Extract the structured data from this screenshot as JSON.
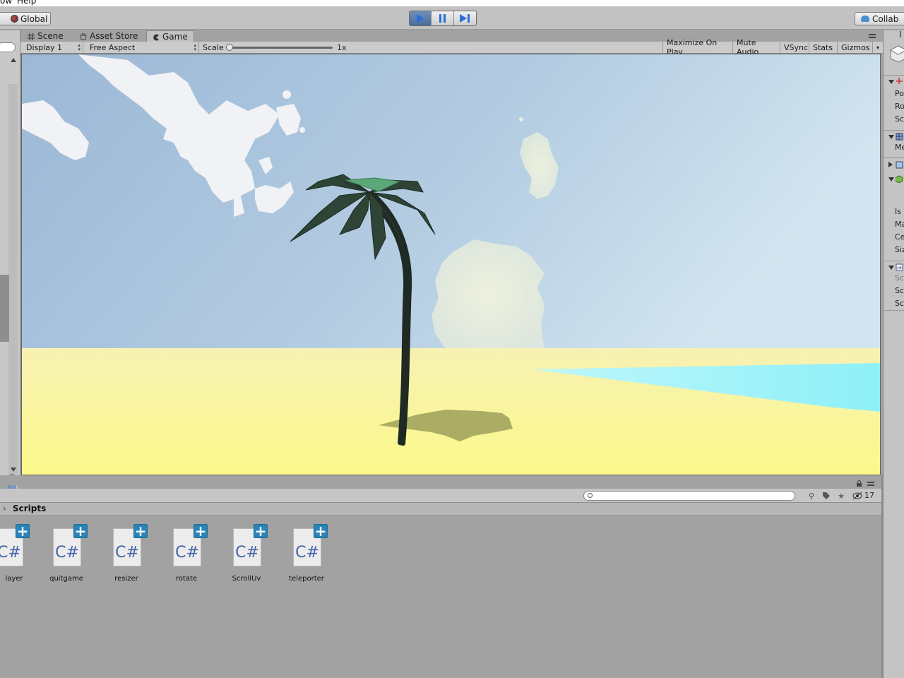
{
  "menubar": {
    "items": [
      "ow",
      "Help"
    ]
  },
  "toolbar": {
    "global_label": "Global",
    "collab_label": "Collab",
    "play_buttons": [
      "play",
      "pause",
      "step"
    ]
  },
  "game_tabs": [
    {
      "label": "Scene",
      "icon": "hash-icon"
    },
    {
      "label": "Asset Store",
      "icon": "store-icon"
    },
    {
      "label": "Game",
      "icon": "pacman-icon",
      "active": true
    }
  ],
  "game_toolbar": {
    "display": "Display 1",
    "aspect": "Free Aspect",
    "scale_label": "Scale",
    "scale_value": "1x",
    "maximize": "Maximize On Play",
    "mute": "Mute Audio",
    "vsync": "VSync",
    "stats": "Stats",
    "gizmos": "Gizmos"
  },
  "inspector": {
    "title_initial": "I",
    "labels": [
      {
        "text": "Po"
      },
      {
        "text": "Ro"
      },
      {
        "text": "Sc"
      },
      {
        "text": "Me"
      },
      {
        "text": "Is"
      },
      {
        "text": "Ma"
      },
      {
        "text": "Ce"
      },
      {
        "text": "Siz"
      },
      {
        "text": "Sc",
        "dim": true
      },
      {
        "text": "Sc"
      },
      {
        "text": "Sc"
      }
    ]
  },
  "project": {
    "breadcrumb": "Scripts",
    "hidden_count": "17",
    "assets": [
      {
        "name": "layer",
        "glyph": "C#"
      },
      {
        "name": "quitgame",
        "glyph": "C#"
      },
      {
        "name": "resizer",
        "glyph": "C#"
      },
      {
        "name": "rotate",
        "glyph": "C#"
      },
      {
        "name": "ScrollUv",
        "glyph": "C#"
      },
      {
        "name": "teleporter",
        "glyph": "C#"
      }
    ]
  },
  "colors": {
    "sky_top": "#b9d3e6",
    "sky_left": "#9bb8d6",
    "sand_top": "#f7f1b3",
    "sand_bottom": "#fbf98a",
    "sea": "#8ef0f8",
    "palm": "#2b3a30",
    "play_active": "#4a6e9c",
    "csharp_blue": "#4466a8",
    "plus_blue": "#2a84b8"
  }
}
